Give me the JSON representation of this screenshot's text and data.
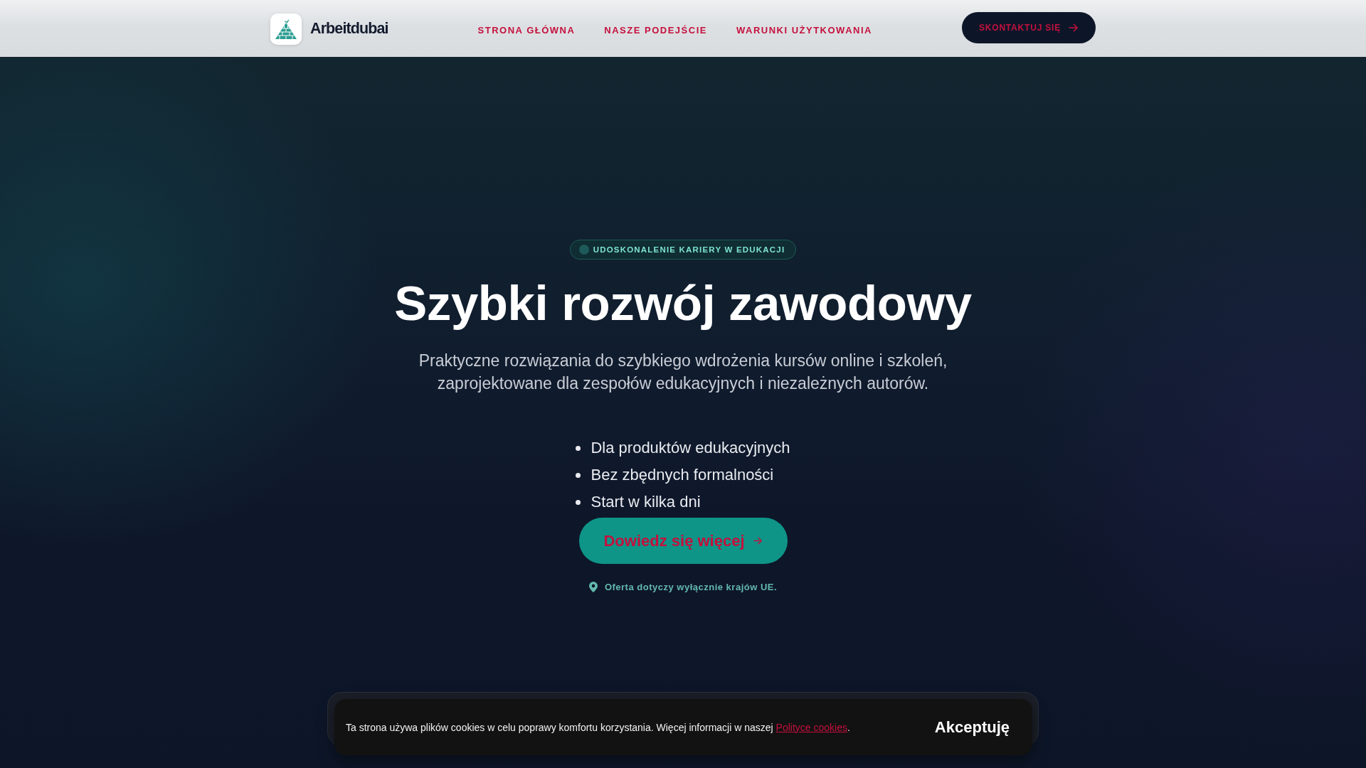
{
  "header": {
    "brand": "Arbeitdubai",
    "nav": [
      {
        "label": "STRONA GŁÓWNA"
      },
      {
        "label": "NASZE PODEJŚCIE"
      },
      {
        "label": "WARUNKI UŻYTKOWANIA"
      }
    ],
    "contact_button": "SKONTAKTUJ SIĘ"
  },
  "hero": {
    "badge": "UDOSKONALENIE KARIERY W EDUKACJI",
    "title": "Szybki rozwój zawodowy",
    "subtitle": "Praktyczne rozwiązania do szybkiego wdrożenia kursów online i szkoleń, zaprojektowane dla zespołów edukacyjnych i niezależnych autorów.",
    "features": [
      "Dla produktów edukacyjnych",
      "Bez zbędnych formalności",
      "Start w kilka dni"
    ],
    "cta": "Dowiedz się więcej",
    "note": "Oferta dotyczy wyłącznie krajów UE."
  },
  "cookie_banner": {
    "message": "Ta strona używa plików cookies w celu poprawy komfortu korzystania. Więcej informacji w naszej",
    "link": "Polityce cookies",
    "after_link": ".",
    "accept": "Akceptuję"
  }
}
